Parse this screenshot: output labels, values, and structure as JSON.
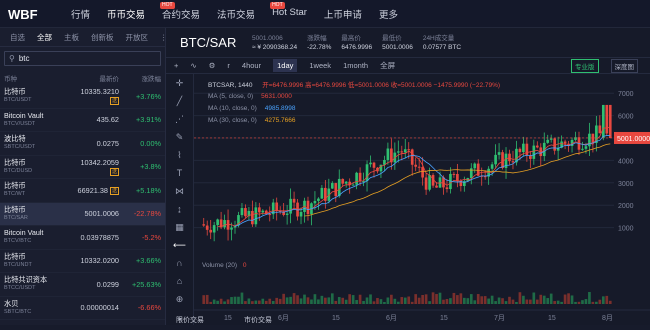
{
  "nav": {
    "items": [
      {
        "label": "行情",
        "hot": false
      },
      {
        "label": "币币交易",
        "hot": false,
        "active": true
      },
      {
        "label": "合约交易",
        "hot": true
      },
      {
        "label": "法币交易",
        "hot": false
      },
      {
        "label": "Hot Star",
        "hot": true
      },
      {
        "label": "上币申请",
        "hot": false
      },
      {
        "label": "更多",
        "hot": false
      }
    ],
    "hot_badge": "HOT"
  },
  "market": {
    "tabs": [
      "自选",
      "全部",
      "主板",
      "创新板",
      "开放区"
    ],
    "search_value": "btc",
    "col_headers": [
      "币种",
      "最新价",
      "涨跌幅"
    ],
    "rows": [
      {
        "name": "比特币",
        "sub": "BTC/USDT",
        "price": "10335.3210",
        "change": "+3.76%",
        "dir": "up",
        "tag": "送"
      },
      {
        "name": "Bitcoin Vault",
        "sub": "BTCV/USDT",
        "price": "435.62",
        "change": "+3.91%",
        "dir": "up",
        "tag": ""
      },
      {
        "name": "波比特",
        "sub": "SBTC/USDT",
        "price": "0.0275",
        "change": "0.00%",
        "dir": "up",
        "tag": ""
      },
      {
        "name": "比特币",
        "sub": "BTC/DUSD",
        "price": "10342.2059",
        "change": "+3.8%",
        "dir": "up",
        "tag": "送"
      },
      {
        "name": "比特币",
        "sub": "BTC/WT",
        "price": "66921.38",
        "change": "+5.18%",
        "dir": "up",
        "tag": "送"
      },
      {
        "name": "比特币",
        "sub": "BTC/SAR",
        "price": "5001.0006",
        "change": "-22.78%",
        "dir": "down",
        "tag": "",
        "selected": true
      },
      {
        "name": "Bitcoin Vault",
        "sub": "BTCV/BTC",
        "price": "0.03978875",
        "change": "-5.2%",
        "dir": "down",
        "tag": ""
      },
      {
        "name": "比特币",
        "sub": "BTC/UNDT",
        "price": "10332.0200",
        "change": "+3.66%",
        "dir": "up",
        "tag": ""
      },
      {
        "name": "比特共识资本",
        "sub": "BTCC/USDT",
        "price": "0.0299",
        "change": "+25.63%",
        "dir": "up",
        "tag": ""
      },
      {
        "name": "水贝",
        "sub": "SBTC/BTC",
        "price": "0.00000014",
        "change": "-6.66%",
        "dir": "down",
        "tag": ""
      }
    ]
  },
  "ticker": {
    "symbol": "BTC/SAR",
    "stats": [
      {
        "l": "5001.0006",
        "v": "≈ ¥ 2090368.24"
      },
      {
        "l": "涨跌幅",
        "v": "-22.78%",
        "cls": "down"
      },
      {
        "l": "最高价",
        "v": "6476.9996"
      },
      {
        "l": "最低价",
        "v": "5001.0006"
      },
      {
        "l": "24H成交量",
        "v": "0.07577 BTC"
      }
    ]
  },
  "toolbar": {
    "timeframes": [
      "r",
      "4hour",
      "1day",
      "1week",
      "1month",
      "全屏"
    ],
    "active_tf": "1day",
    "pro": "专业版",
    "depth": "深度图"
  },
  "chart_legend": {
    "ohlc": "BTCSAR, 1440",
    "ohlc_vals": "开=6476.9996  高=6476.9996  低=5001.0006  收=5001.0006  −1475.9990 (−22.79%)",
    "ma": [
      {
        "label": "MA (5, close, 0)",
        "value": "5631.0000",
        "color": "#e8483f"
      },
      {
        "label": "MA (10, close, 0)",
        "value": "4985.8998",
        "color": "#4aa3ff"
      },
      {
        "label": "MA (30, close, 0)",
        "value": "4275.7666",
        "color": "#e6a023"
      }
    ],
    "volume": "Volume (20)",
    "volume_val": "0",
    "price_tag": "5001.0000"
  },
  "chart_data": {
    "type": "candlestick",
    "y_ticks": [
      7000,
      6000,
      5000,
      4000,
      3000,
      2000,
      1000
    ],
    "ylim": [
      0,
      7500
    ],
    "x_ticks": [
      "15",
      "6月",
      "15",
      "6月",
      "15",
      "7月",
      "15",
      "8月"
    ],
    "last_price": 5001.0006
  },
  "bottom": {
    "tabs": [
      "限价交易",
      "市价交易"
    ]
  }
}
